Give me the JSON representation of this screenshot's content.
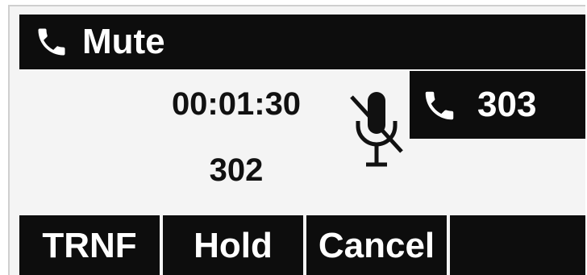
{
  "header": {
    "title": "Mute",
    "icon": "phone-handset-icon"
  },
  "call": {
    "duration": "00:01:30",
    "number": "302",
    "status_icon": "microphone-muted-icon"
  },
  "line": {
    "label": "303",
    "icon": "phone-handset-icon"
  },
  "softkeys": [
    {
      "label": "TRNF"
    },
    {
      "label": "Hold"
    },
    {
      "label": "Cancel"
    },
    {
      "label": ""
    }
  ],
  "colors": {
    "bar": "#0d0d0d",
    "screen": "#f4f4f4",
    "text_on_bar": "#ffffff"
  }
}
